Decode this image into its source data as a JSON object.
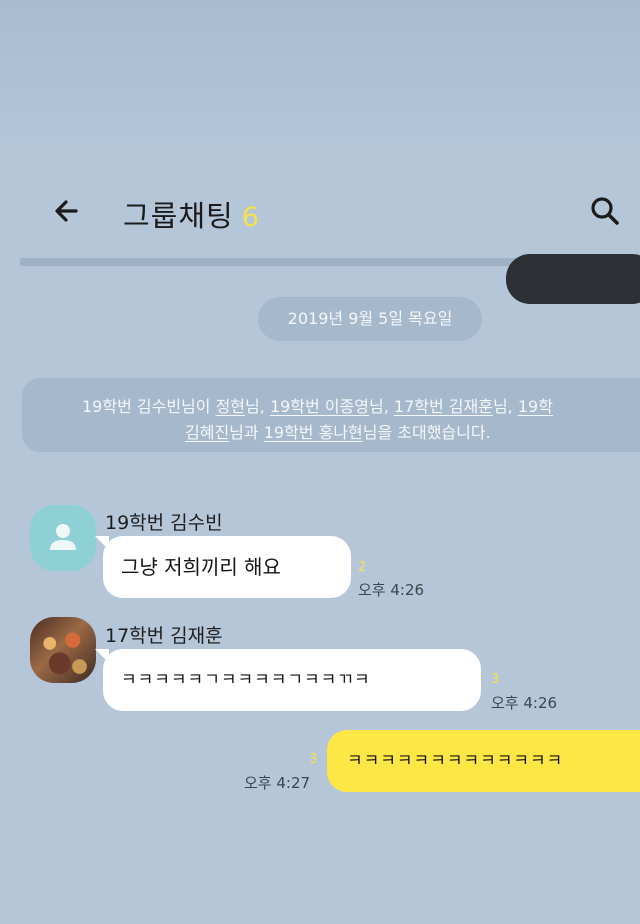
{
  "header": {
    "back_icon": "arrow-left-icon",
    "title": "그룹채팅",
    "member_count": "6",
    "search_icon": "search-icon"
  },
  "date_separator": "2019년 9월 5일 목요일",
  "system_message": {
    "line1": {
      "prefix": "19학번 김수빈님이 ",
      "n1": "정현",
      "s1": "님, ",
      "n2": "19학번 이종영",
      "s2": "님, ",
      "n3": "17학번 김재훈",
      "s3": "님, ",
      "n4": "19학"
    },
    "line2": {
      "n5": "김혜진",
      "s5": "님과 ",
      "n6": "19학번 홍나현",
      "suffix": "님을 초대했습니다."
    }
  },
  "messages": [
    {
      "sender": "19학번 김수빈",
      "text": "그냥 저희끼리 해요",
      "unread": "2",
      "time": "오후 4:26"
    },
    {
      "sender": "17학번 김재훈",
      "text": "ㅋㅋㅋㅋㅋㄱㅋㅋㅋㅋㄱㅋㅋㄲㅋ",
      "unread": "3",
      "time": "오후 4:26"
    },
    {
      "sender": "",
      "text": "ㅋㅋㅋㅋㅋㅋㅋㅋㅋㅋㅋㅋㅋ",
      "unread": "3",
      "time": "오후 4:27"
    }
  ],
  "colors": {
    "background": "#b5c6d9",
    "my_bubble": "#fde745",
    "other_bubble": "#ffffff",
    "unread_count": "#f3e24b"
  }
}
